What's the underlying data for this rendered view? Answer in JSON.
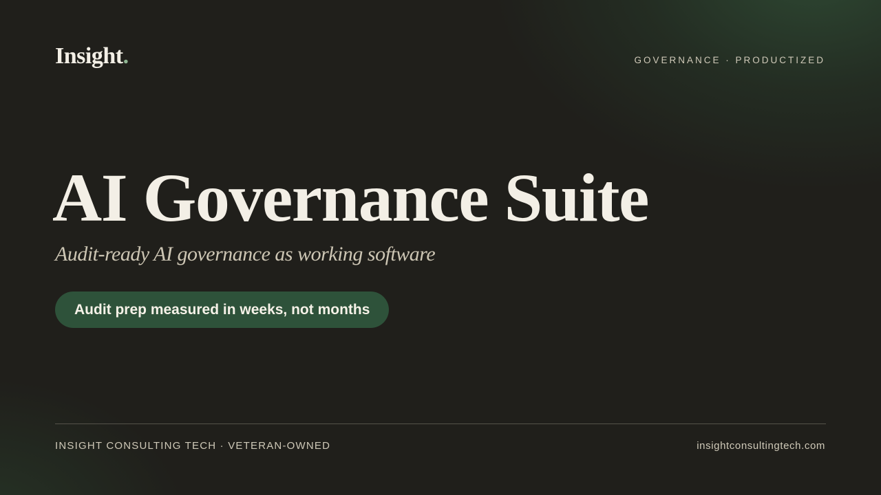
{
  "header": {
    "logo_text": "Insight",
    "logo_dot": ".",
    "tagline": "GOVERNANCE · PRODUCTIZED"
  },
  "hero": {
    "title": "AI Governance Suite",
    "subtitle": "Audit-ready AI governance as working software",
    "pill_label": "Audit prep measured in weeks, not months"
  },
  "footer": {
    "left_text": "INSIGHT CONSULTING TECH · VETERAN-OWNED",
    "right_text": "insightconsultingtech.com"
  },
  "colors": {
    "background": "#201f1b",
    "accent_green": "#2e523a",
    "logo_dot": "#8fb593",
    "text_primary": "#f3efe6",
    "text_muted": "#cfc9b8"
  }
}
